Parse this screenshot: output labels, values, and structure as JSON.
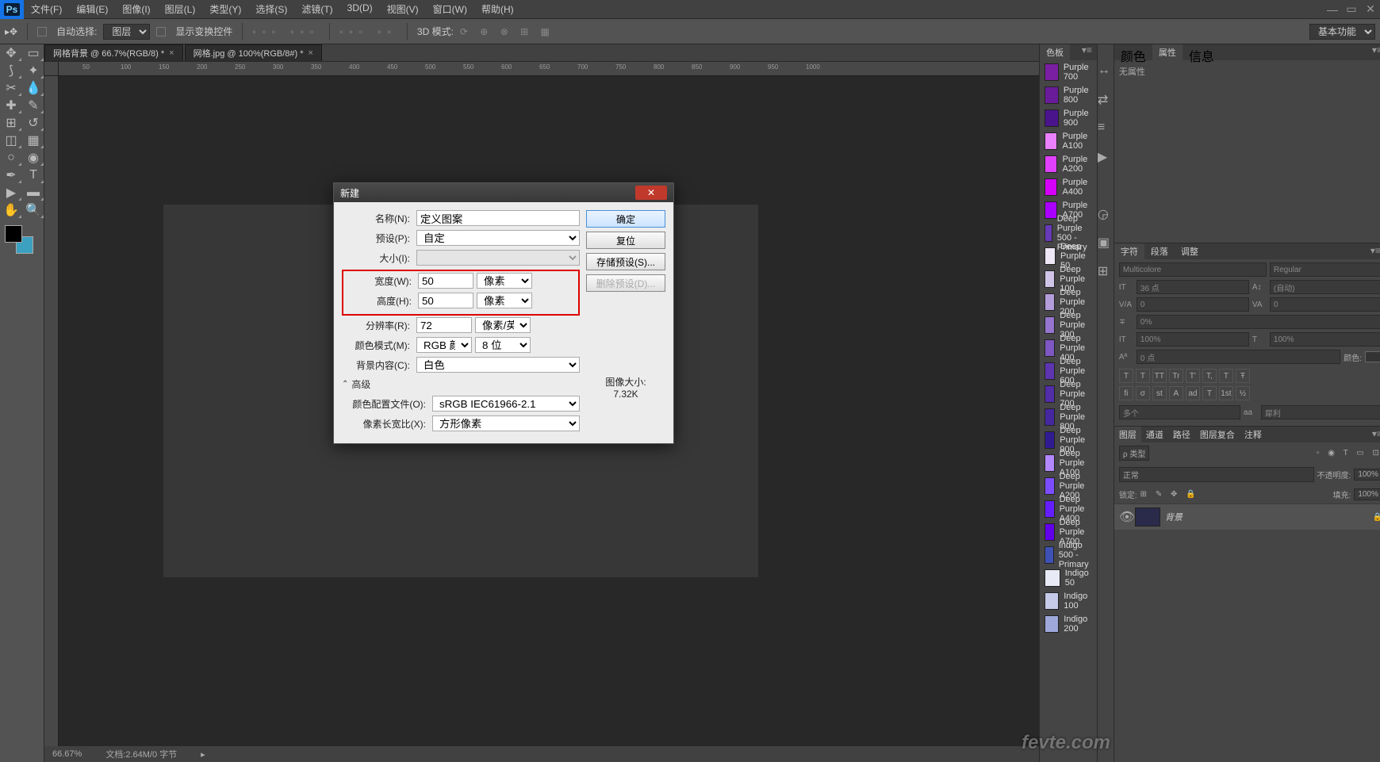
{
  "app": {
    "logo": "Ps"
  },
  "menu": [
    "文件(F)",
    "编辑(E)",
    "图像(I)",
    "图层(L)",
    "类型(Y)",
    "选择(S)",
    "滤镜(T)",
    "3D(D)",
    "视图(V)",
    "窗口(W)",
    "帮助(H)"
  ],
  "options": {
    "auto_select": "自动选择:",
    "layer_select": "图层",
    "show_transform": "显示变换控件",
    "mode3d": "3D 模式:",
    "workspace": "基本功能"
  },
  "tabs": [
    {
      "label": "网格背景 @ 66.7%(RGB/8) *"
    },
    {
      "label": "网格.jpg @ 100%(RGB/8#) *"
    }
  ],
  "ruler_ticks": [
    "50",
    "100",
    "150",
    "200",
    "250",
    "300",
    "350",
    "400",
    "450",
    "500",
    "550",
    "600",
    "650",
    "700",
    "750",
    "800",
    "850",
    "900",
    "950",
    "1000"
  ],
  "swatches": {
    "tab": "色板",
    "items": [
      {
        "name": "Purple 700",
        "color": "#7b1fa2"
      },
      {
        "name": "Purple 800",
        "color": "#6a1b9a"
      },
      {
        "name": "Purple 900",
        "color": "#4a148c"
      },
      {
        "name": "Purple A100",
        "color": "#ea80fc"
      },
      {
        "name": "Purple A200",
        "color": "#e040fb"
      },
      {
        "name": "Purple A400",
        "color": "#d500f9"
      },
      {
        "name": "Purple A700",
        "color": "#aa00ff"
      },
      {
        "name": "Deep Purple 500 - Primary",
        "color": "#673ab7"
      },
      {
        "name": "Deep Purple 50",
        "color": "#ede7f6"
      },
      {
        "name": "Deep Purple 100",
        "color": "#d1c4e9"
      },
      {
        "name": "Deep Purple 200",
        "color": "#b39ddb"
      },
      {
        "name": "Deep Purple 300",
        "color": "#9575cd"
      },
      {
        "name": "Deep Purple 400",
        "color": "#7e57c2"
      },
      {
        "name": "Deep Purple 600",
        "color": "#5e35b1"
      },
      {
        "name": "Deep Purple 700",
        "color": "#512da8"
      },
      {
        "name": "Deep Purple 800",
        "color": "#4527a0"
      },
      {
        "name": "Deep Purple 900",
        "color": "#311b92"
      },
      {
        "name": "Deep Purple A100",
        "color": "#b388ff"
      },
      {
        "name": "Deep Purple A200",
        "color": "#7c4dff"
      },
      {
        "name": "Deep Purple A400",
        "color": "#651fff"
      },
      {
        "name": "Deep Purple A700",
        "color": "#6200ea"
      },
      {
        "name": "Indigo 500 - Primary",
        "color": "#3f51b5"
      },
      {
        "name": "Indigo 50",
        "color": "#e8eaf6"
      },
      {
        "name": "Indigo 100",
        "color": "#c5cae9"
      },
      {
        "name": "Indigo 200",
        "color": "#9fa8da"
      }
    ]
  },
  "right_tabs": {
    "color": "颜色",
    "props": "属性",
    "info": "信息",
    "none": "无属性"
  },
  "char": {
    "tab1": "字符",
    "tab2": "段落",
    "tab3": "调整",
    "font": "Multicolore",
    "style": "Regular",
    "size": "36 点",
    "leading": "(自动)",
    "tracking": "0",
    "metric": "0",
    "scale": "0%",
    "baseline": "0 点",
    "height": "100%",
    "width": "100%",
    "color_label": "颜色:",
    "aa": "多个",
    "aa2": "犀利",
    "styles": [
      "T",
      "T",
      "TT",
      "Tr",
      "T'",
      "T,",
      "T",
      "Ŧ"
    ],
    "opentype": [
      "fi",
      "σ",
      "st",
      "A",
      "ad",
      "T",
      "1st",
      "½"
    ]
  },
  "layers": {
    "tabs": [
      "图层",
      "通道",
      "路径",
      "图层复合",
      "注释"
    ],
    "filter": "ρ 类型",
    "blend": "正常",
    "opacity_label": "不透明度:",
    "opacity": "100%",
    "lock_label": "锁定:",
    "fill_label": "填充:",
    "fill": "100%",
    "bg_layer": "背景"
  },
  "status": {
    "zoom": "66.67%",
    "doc": "文档:2.64M/0 字节"
  },
  "dialog": {
    "title": "新建",
    "name_label": "名称(N):",
    "name_value": "定义图案",
    "preset_label": "预设(P):",
    "preset_value": "自定",
    "size_label": "大小(I):",
    "width_label": "宽度(W):",
    "width_value": "50",
    "width_unit": "像素",
    "height_label": "高度(H):",
    "height_value": "50",
    "height_unit": "像素",
    "res_label": "分辨率(R):",
    "res_value": "72",
    "res_unit": "像素/英寸",
    "mode_label": "颜色模式(M):",
    "mode_value": "RGB 颜色",
    "mode_depth": "8 位",
    "bg_label": "背景内容(C):",
    "bg_value": "白色",
    "advanced": "高级",
    "profile_label": "颜色配置文件(O):",
    "profile_value": "sRGB IEC61966-2.1",
    "aspect_label": "像素长宽比(X):",
    "aspect_value": "方形像素",
    "btn_ok": "确定",
    "btn_reset": "复位",
    "btn_save": "存储预设(S)...",
    "btn_delete": "删除预设(D)...",
    "size_title": "图像大小:",
    "size_value": "7.32K"
  },
  "watermark": "fevte.com"
}
